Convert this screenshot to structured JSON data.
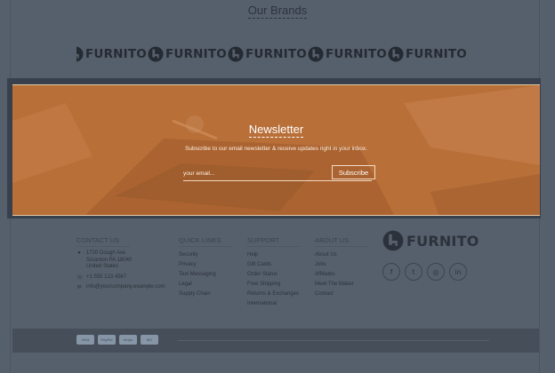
{
  "brands": {
    "title": "Our Brands",
    "logo_text": "FURNITO",
    "logo_count": 6
  },
  "newsletter": {
    "title": "Newsletter",
    "description": "Subscribe to our email newsletter & receive updates right in your inbox.",
    "email_placeholder": "your email...",
    "subscribe_label": "Subscribe"
  },
  "footer": {
    "contact": {
      "heading": "CONTACT US",
      "address_lines": [
        "1720 Dough Ave",
        "Scranton PA 18040",
        "United States"
      ],
      "phone": "+1 555 123 4567",
      "email": "info@yourcompany.example.com"
    },
    "quick_links": {
      "heading": "QUICK LINKS",
      "items": [
        "Security",
        "Privacy",
        "Text Messaging",
        "Legal",
        "Supply Chain"
      ]
    },
    "support": {
      "heading": "SUPPORT",
      "items": [
        "Help",
        "Gift Cards",
        "Order Status",
        "Free Shipping",
        "Returns & Exchanges",
        "International"
      ]
    },
    "about": {
      "heading": "ABOUT US",
      "items": [
        "About Us",
        "Jobs",
        "Affiliates",
        "Meet The Maker",
        "Contact"
      ]
    },
    "logo_text": "FURNITO",
    "social": [
      {
        "icon": "facebook-icon",
        "glyph": "f"
      },
      {
        "icon": "twitter-icon",
        "glyph": "t"
      },
      {
        "icon": "instagram-icon",
        "glyph": "◎"
      },
      {
        "icon": "linkedin-icon",
        "glyph": "in"
      }
    ]
  },
  "payments": [
    "VISA",
    "PayPal",
    "stripe",
    "MC"
  ],
  "colors": {
    "overlay": "#56606c",
    "newsletter_bg": "#b86f38",
    "text_dark": "#2b323b"
  }
}
